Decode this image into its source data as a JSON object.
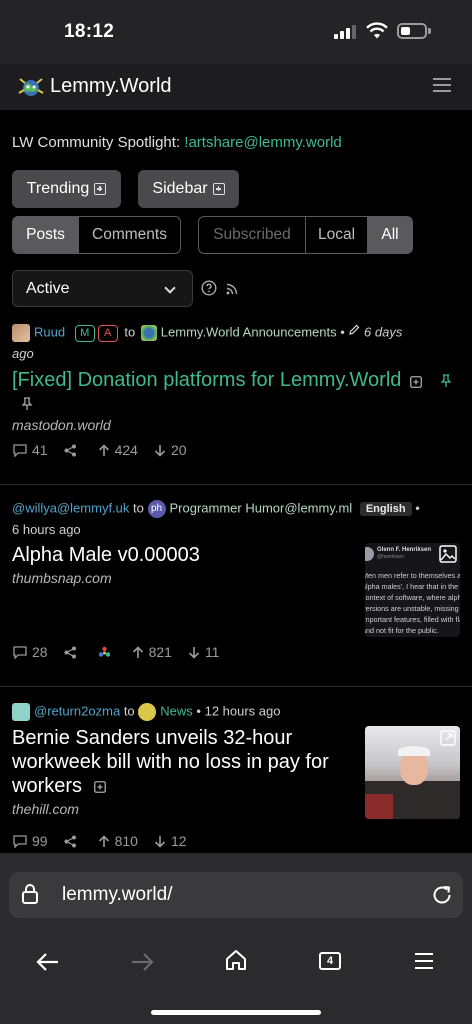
{
  "status": {
    "time": "18:12"
  },
  "header": {
    "brand": "Lemmy.World"
  },
  "spotlight": {
    "prefix": "LW Community Spotlight: ",
    "link": "!artshare@lemmy.world"
  },
  "buttons": {
    "trending": "Trending",
    "sidebar": "Sidebar"
  },
  "tabs": {
    "posts": "Posts",
    "comments": "Comments"
  },
  "listing": {
    "subscribed": "Subscribed",
    "local": "Local",
    "all": "All"
  },
  "sort": {
    "selected": "Active"
  },
  "posts": [
    {
      "user": "Ruud",
      "badge_m": "M",
      "badge_a": "A",
      "to": "to",
      "community": "Lemmy.World Announcements",
      "time": "6 days",
      "time2": "ago",
      "title": "[Fixed] Donation platforms for Lemmy.World",
      "domain": "mastodon.world",
      "comments": "41",
      "up": "424",
      "down": "20"
    },
    {
      "user": "@willya@lemmyf.uk",
      "to": "to",
      "community": "Programmer Humor@lemmy.ml",
      "lang": "English",
      "time": "6 hours ago",
      "title": "Alpha Male v0.00003",
      "domain": "thumbsnap.com",
      "comments": "28",
      "up": "821",
      "down": "11",
      "thumb_name": "Glenn F. Henriksen",
      "thumb_handle": "@henriksen",
      "thumb_text": [
        "Men men refer to themselves a",
        "alpha males', I hear that in the",
        "context of software, where alpha",
        "versions are unstable, missing",
        "important features, filled with fla",
        "and not fit for the public."
      ]
    },
    {
      "user": "@return2ozma",
      "to": "to",
      "community": "News",
      "time": "12 hours ago",
      "title_lines": [
        "Bernie Sanders unveils 32-hour",
        "workweek bill with no loss in pay for",
        "workers"
      ],
      "domain": "thehill.com",
      "comments": "99",
      "up": "810",
      "down": "12"
    }
  ],
  "browser": {
    "url": "lemmy.world/",
    "tab_count": "4"
  }
}
